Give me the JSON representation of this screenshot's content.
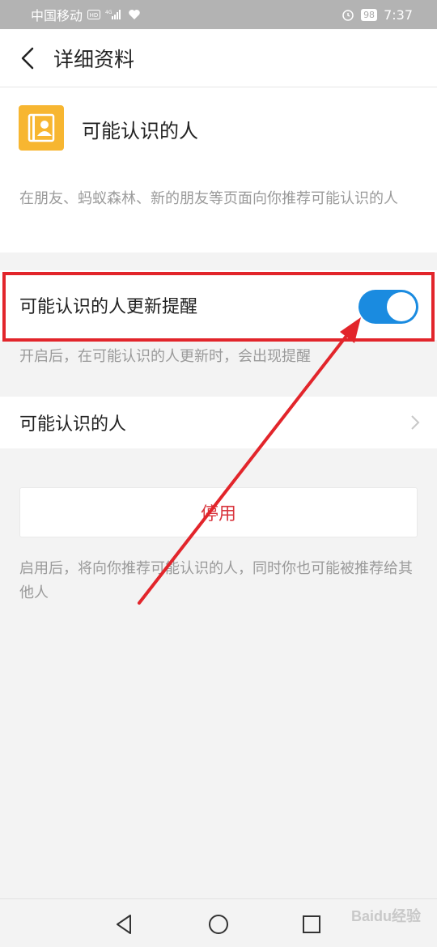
{
  "status_bar": {
    "carrier": "中国移动",
    "battery": "98",
    "time": "7:37"
  },
  "header": {
    "title": "详细资料"
  },
  "info": {
    "title": "可能认识的人",
    "description": "在朋友、蚂蚁森林、新的朋友等页面向你推荐可能认识的人"
  },
  "update_reminder": {
    "label": "可能认识的人更新提醒",
    "enabled": true,
    "hint": "开启后，在可能认识的人更新时，会出现提醒"
  },
  "nav_row": {
    "label": "可能认识的人"
  },
  "disable": {
    "button_label": "停用",
    "hint": "启用后，将向你推荐可能认识的人，同时你也可能被推荐给其他人"
  },
  "colors": {
    "accent_blue": "#1a8be0",
    "disable_red": "#d9363e",
    "highlight_red": "#e2252b",
    "app_icon_yellow": "#f7b631"
  },
  "icons": {
    "back": "back-arrow-icon",
    "app": "contact-book-icon",
    "chevron": "chevron-right-icon",
    "nav_back": "triangle-back-icon",
    "nav_home": "circle-home-icon",
    "nav_recent": "square-recent-icon"
  },
  "watermark": "Baidu经验"
}
